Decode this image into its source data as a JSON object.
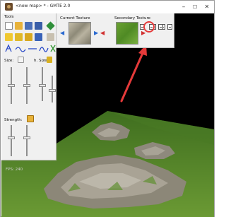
{
  "window": {
    "title": "<new map> * - GMTE 2.0",
    "minimize": "–",
    "maximize": "☐",
    "close": "✕"
  },
  "tools_panel": {
    "title": "Tools",
    "size_label": "Size:",
    "height_size_label": "h. Size:",
    "strength_label": "Strength:",
    "size_level": 0.5,
    "height_size_level": 0.45,
    "strength_level": 0.6
  },
  "texture_panel": {
    "current_label": "Current Texture",
    "secondary_label": "Secondary Texture"
  },
  "viewport": {
    "fps": "FPS: 240"
  },
  "colors": {
    "annotation": "#e53a3a",
    "grass": "#5a8a2a",
    "rock": "#8f8a80"
  }
}
